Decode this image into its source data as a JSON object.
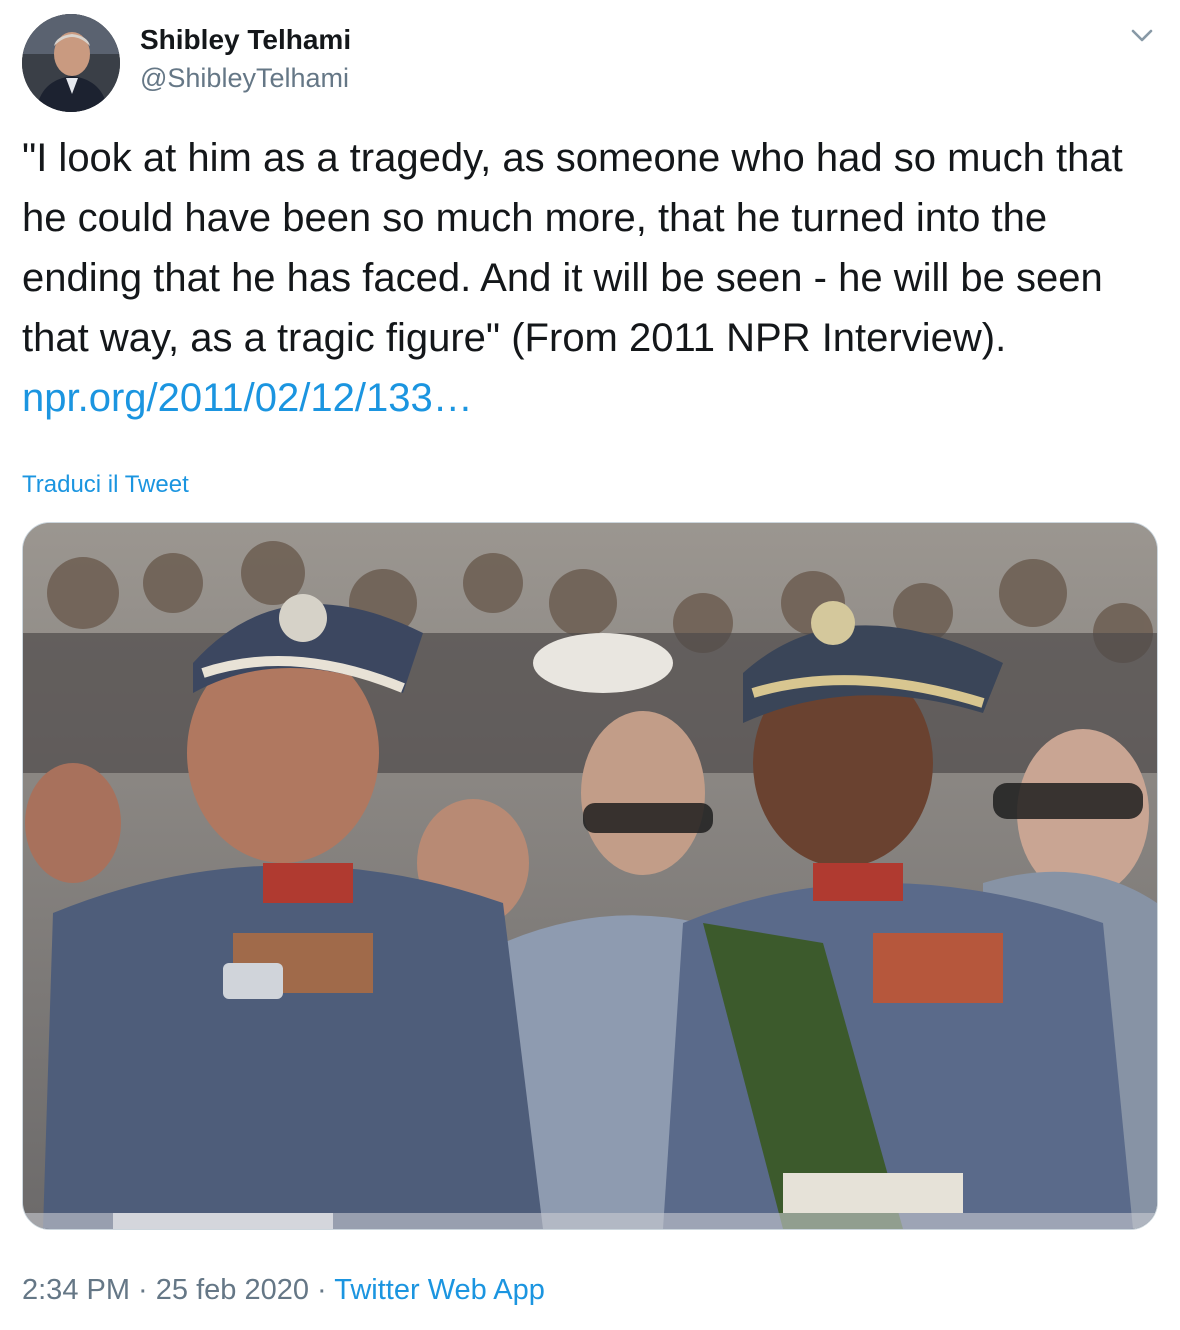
{
  "author": {
    "display_name": "Shibley Telhami",
    "handle": "@ShibleyTelhami"
  },
  "tweet": {
    "text": "\"I look at him as a tragedy, as someone who had so much that he could have been so much more, that he turned into the ending that he has faced. And it will be seen - he will be seen that way, as a tragic figure\" (From 2011 NPR Interview). ",
    "link_text": "npr.org/2011/02/12/133…",
    "translate_label": "Traduci il Tweet"
  },
  "meta": {
    "time": "2:34 PM",
    "separator_1": " · ",
    "date": "25 feb 2020",
    "separator_2": " · ",
    "source": "Twitter Web App"
  },
  "icons": {
    "menu": "chevron-down-icon"
  },
  "colors": {
    "link": "#1b95e0",
    "secondary_text": "#657786",
    "primary_text": "#14171a"
  }
}
